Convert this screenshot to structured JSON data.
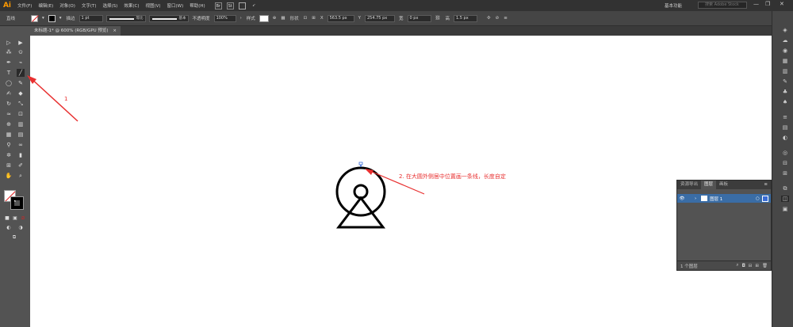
{
  "app": {
    "logo": "Ai"
  },
  "menus": [
    "文件(F)",
    "编辑(E)",
    "对象(O)",
    "文字(T)",
    "选择(S)",
    "效果(C)",
    "视图(V)",
    "窗口(W)",
    "帮助(H)"
  ],
  "menubar_icons": {
    "br": "Br",
    "st": "St"
  },
  "workspace": {
    "label": "基本功能",
    "search_placeholder": "搜索 Adobe Stock"
  },
  "window_controls": {
    "minimize": "—",
    "restore": "❐",
    "close": "✕"
  },
  "control": {
    "selection_label": "直线",
    "stroke_label": "描边",
    "stroke_weight": "1 pt",
    "profile_label": "等比",
    "brush_label": "基本",
    "opacity_label": "不透明度",
    "opacity_value": "100%",
    "style_label": "样式",
    "shape_label": "形状",
    "x_label": "X",
    "x_value": "563.5 px",
    "y_label": "Y",
    "y_value": "254.75 px",
    "w_label": "宽",
    "w_value": "0 px",
    "h_label": "高",
    "h_value": "1.5 px"
  },
  "document_tab": {
    "title": "未标题-1* @ 600% (RGB/GPU 预览)",
    "close": "×"
  },
  "layers_panel": {
    "tabs": [
      "资源导出",
      "图层",
      "画板"
    ],
    "active_tab": "图层",
    "layer_name": "图层 1",
    "footer_count": "1 个图层"
  },
  "annotations": {
    "step1": "1",
    "step2": "2. 在大圆外侧居中位置画一条线，长度自定"
  },
  "colors": {
    "annotation": "#e83030",
    "accent_orange": "#ff9a00",
    "selection_blue": "#3a6da6"
  }
}
